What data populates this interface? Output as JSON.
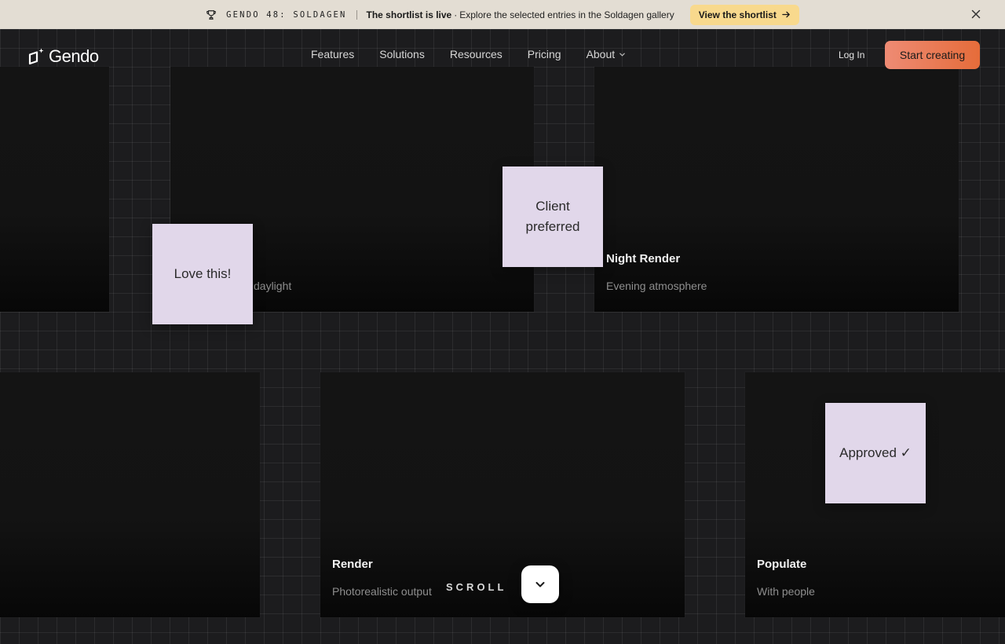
{
  "banner": {
    "event": "GENDO 48: SOLDAGEN",
    "headline": "The shortlist is live",
    "separator": "·",
    "description": "Explore the selected entries in the Soldagen gallery",
    "button": "View the shortlist",
    "icons": {
      "trophy": "trophy-icon",
      "arrow": "arrow-right-icon",
      "close": "close-icon"
    }
  },
  "header": {
    "logo": "Gendo",
    "nav": [
      {
        "label": "Features"
      },
      {
        "label": "Solutions"
      },
      {
        "label": "Resources"
      },
      {
        "label": "Pricing"
      },
      {
        "label": "About",
        "has_dropdown": true
      }
    ],
    "login": "Log In",
    "cta": "Start creating",
    "cta_colors": [
      "#ee8b74",
      "#e56c3a"
    ]
  },
  "cards": [
    {
      "title": "",
      "subtitle": "daylight"
    },
    {
      "title": "Night Render",
      "subtitle": "Evening atmosphere"
    },
    {
      "title": "Render",
      "subtitle": "Photorealistic output"
    },
    {
      "title": "Populate",
      "subtitle": "With people"
    }
  ],
  "notes": [
    {
      "text": "Love this!"
    },
    {
      "text": "Client preferred"
    },
    {
      "text": "Approved ✓"
    }
  ],
  "scroll": {
    "label": "SCROLL",
    "icon": "chevron-down-icon"
  },
  "colors": {
    "banner_bg": "#e3ddd3",
    "banner_button": "#f8d98d",
    "page_bg": "#1c1c1e",
    "note_bg": "#e1d7ea"
  }
}
